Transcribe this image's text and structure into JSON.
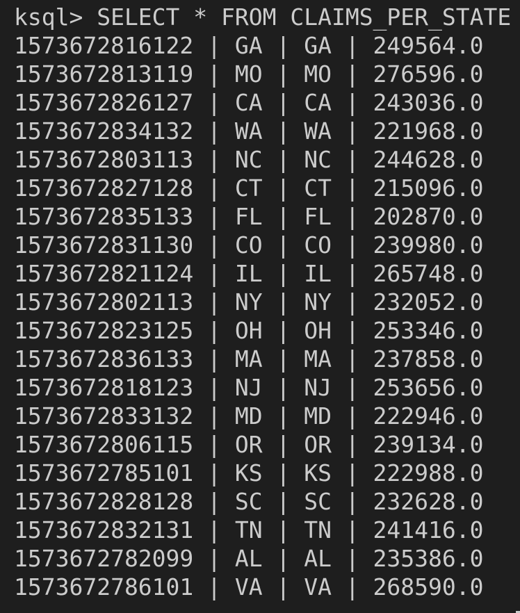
{
  "terminal": {
    "partial_line": "                                                                ",
    "prompt": "ksql> SELECT * FROM CLAIMS_PER_STATE",
    "rows": [
      "1573672816122 | GA | GA | 249564.0",
      "1573672813119 | MO | MO | 276596.0",
      "1573672826127 | CA | CA | 243036.0",
      "1573672834132 | WA | WA | 221968.0",
      "1573672803113 | NC | NC | 244628.0",
      "1573672827128 | CT | CT | 215096.0",
      "1573672835133 | FL | FL | 202870.0",
      "1573672831130 | CO | CO | 239980.0",
      "1573672821124 | IL | IL | 265748.0",
      "1573672802113 | NY | NY | 232052.0",
      "1573672823125 | OH | OH | 253346.0",
      "1573672836133 | MA | MA | 237858.0",
      "1573672818123 | NJ | NJ | 253656.0",
      "1573672833132 | MD | MD | 222946.0",
      "1573672806115 | OR | OR | 239134.0",
      "1573672785101 | KS | KS | 222988.0",
      "1573672828128 | SC | SC | 232628.0",
      "1573672832131 | TN | TN | 241416.0",
      "1573672782099 | AL | AL | 235386.0",
      "1573672786101 | VA | VA | 268590.0"
    ]
  }
}
